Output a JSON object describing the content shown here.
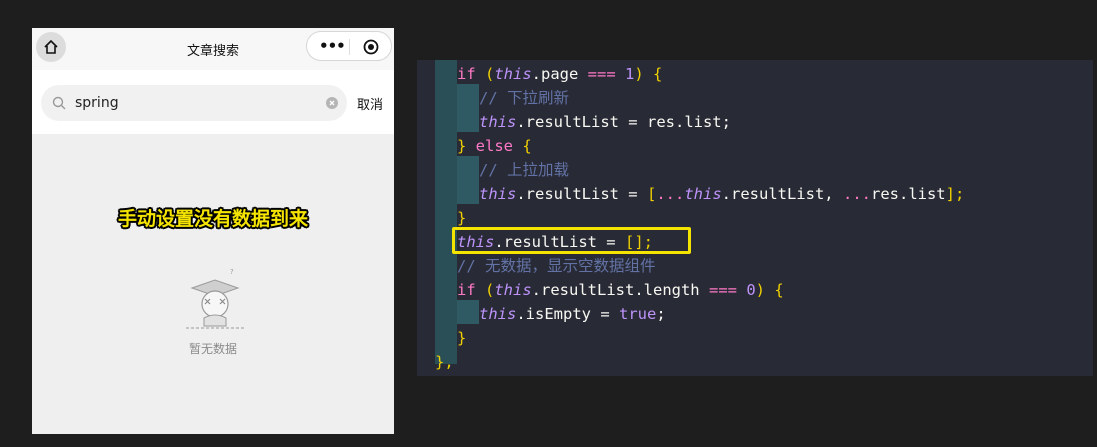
{
  "phone": {
    "nav_title": "文章搜索",
    "search_value": "spring",
    "cancel_label": "取消",
    "overlay_caption": "手动设置没有数据到来",
    "empty_text": "暂无数据",
    "colors": {
      "caption": "#f5e400",
      "background": "#efefef"
    },
    "icons": [
      "home-icon",
      "more-dots-icon",
      "target-icon",
      "search-icon",
      "clear-icon"
    ]
  },
  "editor": {
    "lines": [
      [
        "if",
        "(",
        "this",
        ".page",
        "===",
        "1",
        ")",
        "{"
      ],
      [
        "// 下拉刷新"
      ],
      [
        "this",
        ".resultList = ",
        "res",
        ".list;"
      ],
      [
        "}",
        "else",
        "{"
      ],
      [
        "// 上拉加载"
      ],
      [
        "this",
        ".resultList = ",
        "[",
        "...",
        "this",
        ".resultList, ",
        "...",
        "res",
        ".list",
        "];"
      ],
      [
        "}"
      ],
      [
        "this",
        ".resultList = ",
        "[",
        "];"
      ],
      [
        "// 无数据，显示空数据组件"
      ],
      [
        "if",
        "(",
        "this",
        ".resultList.length ",
        "===",
        "0",
        ")",
        "{"
      ],
      [
        "this",
        ".isEmpty = ",
        "true",
        ";"
      ],
      [
        "}"
      ],
      [
        "},"
      ]
    ],
    "colors": {
      "highlight": "#f5e400",
      "background": "#282a36"
    }
  }
}
